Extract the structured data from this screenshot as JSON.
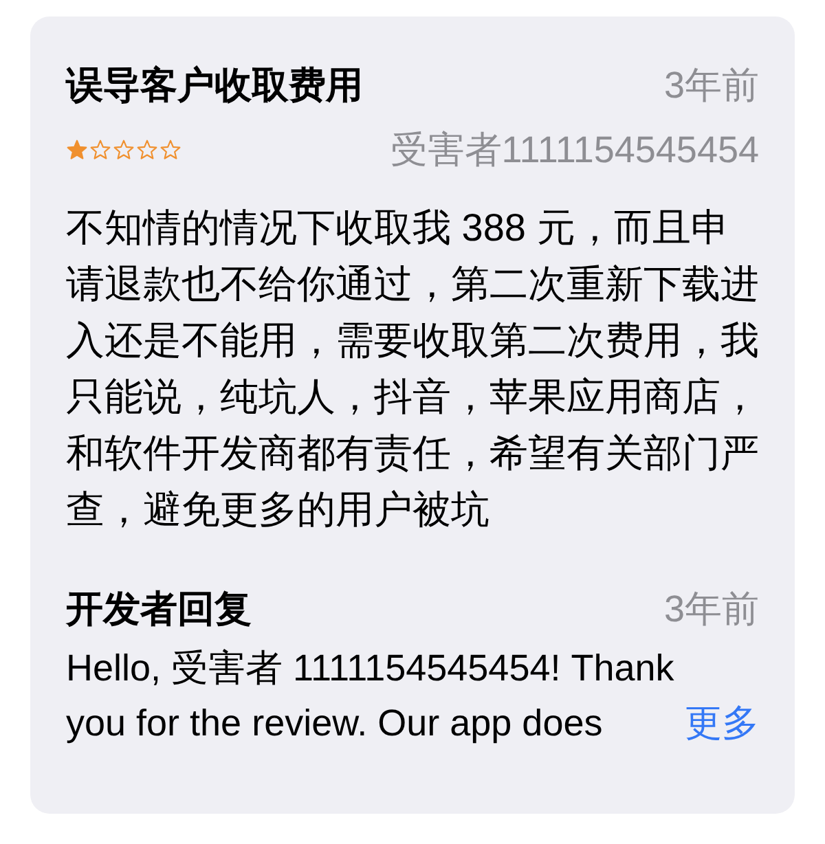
{
  "review": {
    "title": "误导客户收取费用",
    "time": "3年前",
    "stars": 1,
    "author": "受害者1111154545454",
    "body": "不知情的情况下收取我 388 元，而且申请退款也不给你通过，第二次重新下载进入还是不能用，需要收取第二次费用，我只能说，纯坑人，抖音，苹果应用商店，和软件开发商都有责任，希望有关部门严查，避免更多的用户被坑"
  },
  "developer_response": {
    "title": "开发者回复",
    "time": "3年前",
    "text_lines": [
      "Hello, 受害者 1111154545454! Thank",
      "you for the review. Our app does"
    ],
    "more": "更多"
  }
}
